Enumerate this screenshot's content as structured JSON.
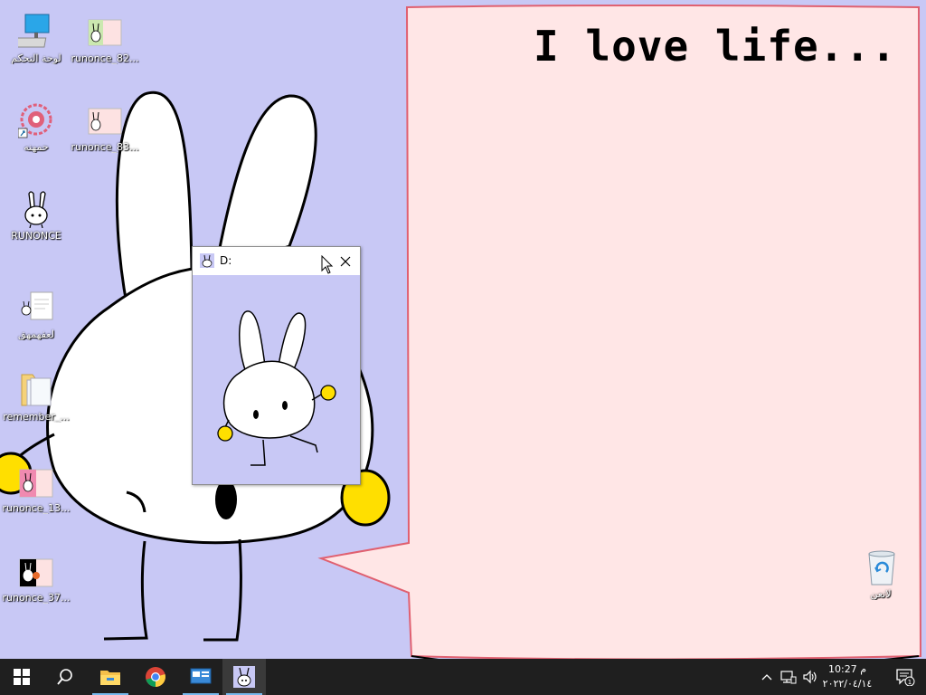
{
  "wallpaper": {
    "message": "I love life..."
  },
  "desktop_icons": [
    {
      "label": "لوحة التحكم",
      "icon": "computer-icon"
    },
    {
      "label": "runonce_82...",
      "icon": "image-file-icon"
    },
    {
      "label": "حمهنه",
      "icon": "flower-shortcut-icon"
    },
    {
      "label": "runonce_83...",
      "icon": "image-file-icon"
    },
    {
      "label": "RUNONCE",
      "icon": "bunny-icon"
    },
    {
      "label": "لعفهمهق",
      "icon": "document-icon"
    },
    {
      "label": "remember_...",
      "icon": "folder-icon"
    },
    {
      "label": "runonce_13...",
      "icon": "image-file-icon"
    },
    {
      "label": "runonce_37...",
      "icon": "image-file-icon"
    },
    {
      "label": "لانعن",
      "icon": "recycle-bin-icon"
    }
  ],
  "popup": {
    "title": "D:",
    "close_icon": "close-icon"
  },
  "taskbar": {
    "items": [
      "start-icon",
      "search-icon",
      "file-explorer-icon",
      "chrome-icon",
      "control-panel-icon",
      "bunny-app-icon"
    ],
    "tray_icons": [
      "chevron-up-icon",
      "network-icon",
      "volume-icon"
    ],
    "time": "10:27 م",
    "date": "٢٠٢٢/٠٤/١٤",
    "notification_count": "1"
  },
  "colors": {
    "desktop_background": "#c8c8f5",
    "speech_bubble": "#ffe6e6",
    "speech_bubble_border": "#e06070",
    "taskbar": "#1f1f1f",
    "accent": "#76b9ed"
  }
}
